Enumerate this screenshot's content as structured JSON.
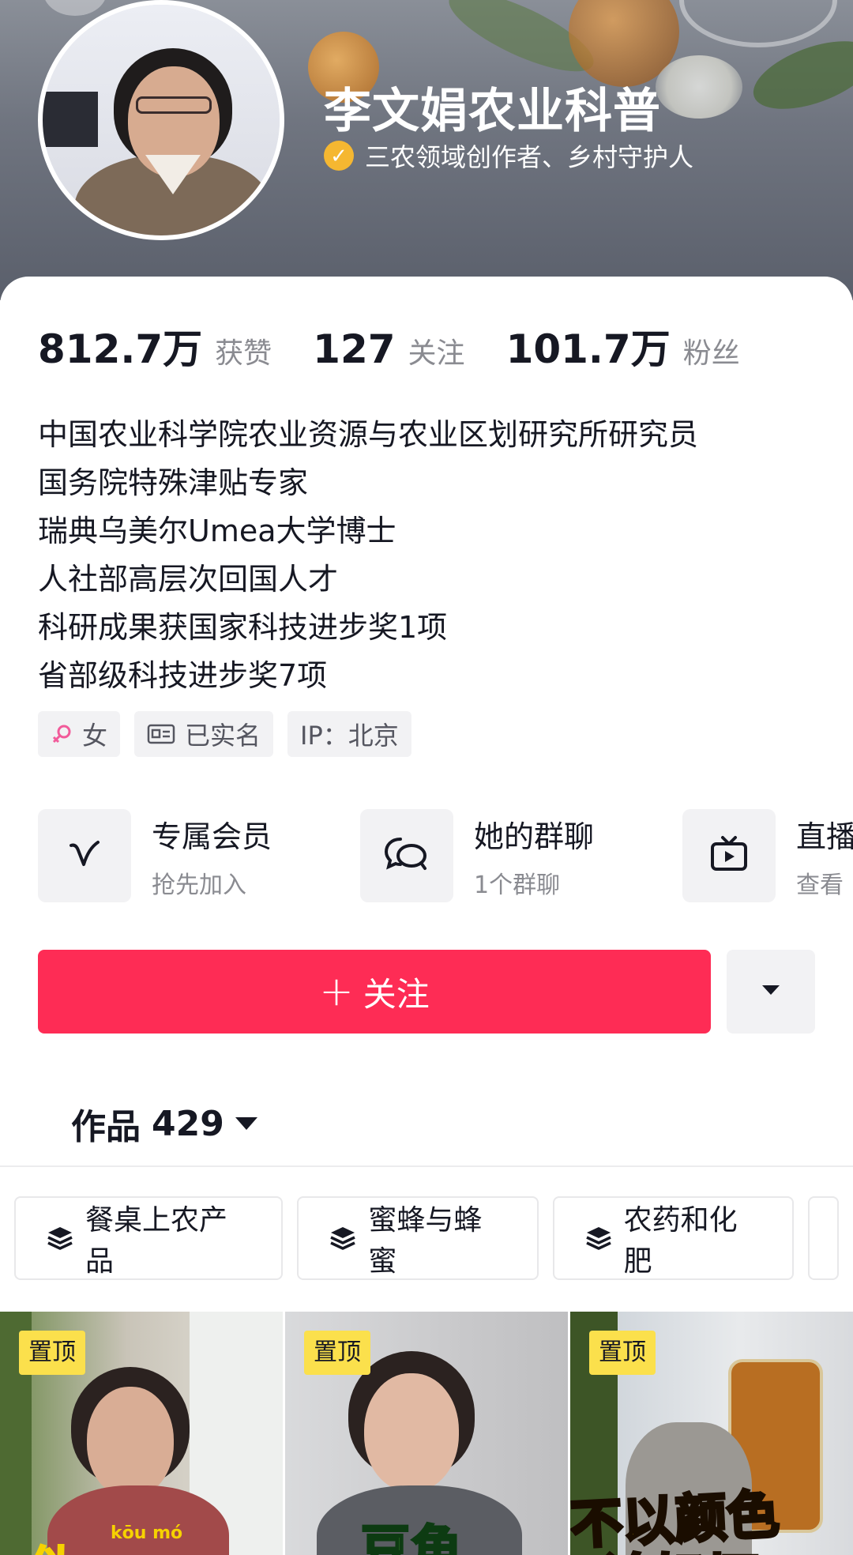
{
  "header": {
    "title": "李文娟农业科普",
    "verify_icon": "check-icon",
    "verify_text": "三农领域创作者、乡村守护人"
  },
  "stats": [
    {
      "num": "812.7万",
      "label": "获赞"
    },
    {
      "num": "127",
      "label": "关注"
    },
    {
      "num": "101.7万",
      "label": "粉丝"
    }
  ],
  "bio": [
    "中国农业科学院农业资源与农业区划研究所研究员",
    "国务院特殊津贴专家",
    "瑞典乌美尔Umea大学博士",
    "人社部高层次回国人才",
    "科研成果获国家科技进步奖1项",
    "省部级科技进步奖7项"
  ],
  "tags": {
    "gender": "女",
    "verified": "已实名",
    "ip": "IP：北京"
  },
  "features": [
    {
      "title": "专属会员",
      "sub": "抢先加入",
      "icon": "v-icon"
    },
    {
      "title": "她的群聊",
      "sub": "1个群聊",
      "icon": "chat-bubbles-icon"
    },
    {
      "title": "直播",
      "sub": "查看",
      "icon": "tv-icon"
    }
  ],
  "actions": {
    "follow_label": "关注",
    "more_icon": "caret-down-icon"
  },
  "works": {
    "label": "作品",
    "count": "429"
  },
  "collections": [
    {
      "label": "餐桌上农产品",
      "icon": "stack-icon"
    },
    {
      "label": "蜜蜂与蜂蜜",
      "icon": "stack-icon"
    },
    {
      "label": "农药和化肥",
      "icon": "stack-icon"
    }
  ],
  "videos": [
    {
      "pin": "置顶",
      "overlay": "伪",
      "pinyin": "kōu  mó"
    },
    {
      "pin": "置顶",
      "overlay": "豆角"
    },
    {
      "pin": "置顶",
      "overlay": "不以颜色",
      "overlay2": "论好坏"
    }
  ],
  "colors": {
    "accent": "#fe2c55",
    "verify": "#f5b731",
    "pin_badge": "#fbe04c",
    "text_primary": "#161823",
    "text_secondary": "#8a8b91"
  }
}
